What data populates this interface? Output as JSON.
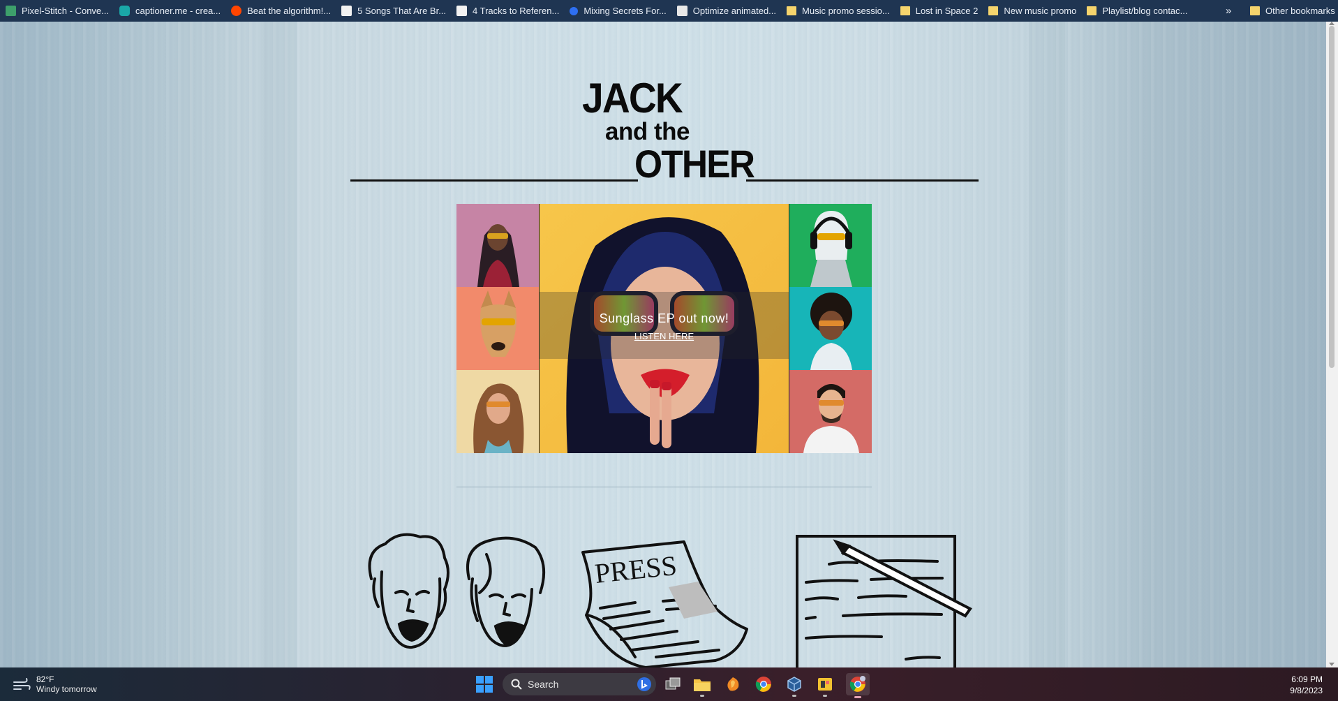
{
  "bookmarks": {
    "items": [
      {
        "label": "Pixel-Stitch - Conve...",
        "icon": "grid-icon"
      },
      {
        "label": "captioner.me - crea...",
        "icon": "captioner-icon"
      },
      {
        "label": "Beat the algorithm!...",
        "icon": "reddit-icon"
      },
      {
        "label": "5 Songs That Are Br...",
        "icon": "page-icon"
      },
      {
        "label": "4 Tracks to Referen...",
        "icon": "page-icon"
      },
      {
        "label": "Mixing Secrets For...",
        "icon": "blue-dot-icon"
      },
      {
        "label": "Optimize animated...",
        "icon": "page-icon"
      },
      {
        "label": "Music promo sessio...",
        "icon": "folder-icon"
      },
      {
        "label": "Lost in Space 2",
        "icon": "folder-icon"
      },
      {
        "label": "New music promo",
        "icon": "folder-icon"
      },
      {
        "label": "Playlist/blog contac...",
        "icon": "folder-icon"
      }
    ],
    "more": "»",
    "other": "Other bookmarks"
  },
  "logo": {
    "line1": "JACK",
    "line2": "and the",
    "line3": "OTHER"
  },
  "hero": {
    "headline": "Sunglass EP out now!",
    "link": "LISTEN HERE"
  },
  "sections": {
    "press_word": "PRESS"
  },
  "taskbar": {
    "weather_temp": "82°F",
    "weather_desc": "Windy tomorrow",
    "search": "Search",
    "time": "6:09 PM",
    "date": "9/8/2023"
  },
  "colors": {
    "bookmark_bar": "#1f3552",
    "page_bg": "#cddde5",
    "ink": "#0b0b0b"
  }
}
